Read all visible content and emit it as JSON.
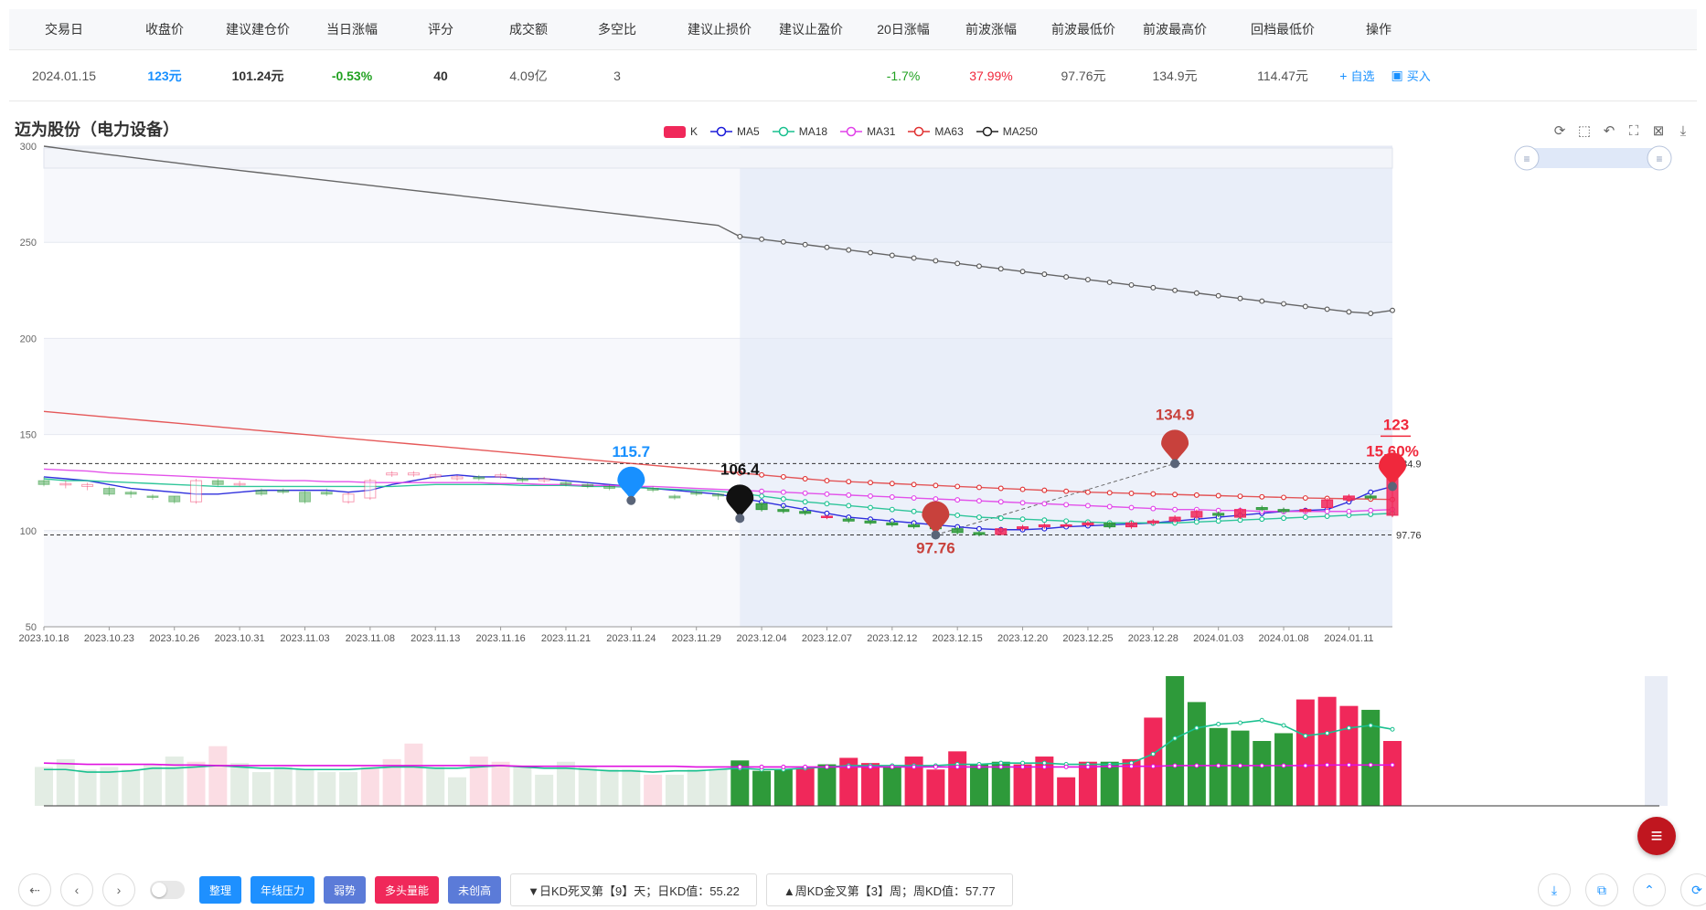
{
  "table": {
    "headers": [
      "交易日",
      "收盘价",
      "建议建仓价",
      "当日涨幅",
      "评分",
      "成交额",
      "多空比",
      "建议止损价",
      "建议止盈价",
      "20日涨幅",
      "前波涨幅",
      "前波最低价",
      "前波最高价",
      "回档最低价",
      "操作"
    ],
    "row": [
      "2024.01.15",
      "123元",
      "101.24元",
      "-0.53%",
      "40",
      "4.09亿",
      "3",
      "",
      "",
      "-1.7%",
      "37.99%",
      "97.76元",
      "134.9元",
      "114.47元"
    ],
    "ops": [
      "自选",
      "买入"
    ],
    "op_icons": [
      "plus-icon",
      "buy-icon"
    ]
  },
  "chart_title": "迈为股份（电力设备）",
  "legend": [
    {
      "name": "K",
      "color": "#f0285a"
    },
    {
      "name": "MA5",
      "color": "#1a1ad9"
    },
    {
      "name": "MA18",
      "color": "#19c08f"
    },
    {
      "name": "MA31",
      "color": "#e040e8"
    },
    {
      "name": "MA63",
      "color": "#e03030"
    },
    {
      "name": "MA250",
      "color": "#222222"
    }
  ],
  "toolbox_icons": [
    "refresh-icon",
    "zoom-area-icon",
    "zoom-reset-icon",
    "restore-icon",
    "data-view-icon",
    "download-icon"
  ],
  "chart_data": {
    "type": "candlestick",
    "y_ticks": [
      "300",
      "250",
      "200",
      "150",
      "100",
      "50"
    ],
    "ylim": [
      50,
      300
    ],
    "x_tick_labels": [
      "2023.10.18",
      "2023.10.23",
      "2023.10.26",
      "2023.10.31",
      "2023.11.03",
      "2023.11.08",
      "2023.11.13",
      "2023.11.16",
      "2023.11.21",
      "2023.11.24",
      "2023.11.29",
      "2023.12.04",
      "2023.12.07",
      "2023.12.12",
      "2023.12.15",
      "2023.12.20",
      "2023.12.25",
      "2023.12.28",
      "2024.01.03",
      "2024.01.08",
      "2024.01.11"
    ],
    "n_days": 63,
    "highlight_start_index": 32,
    "candles": [
      [
        126,
        124,
        128,
        123
      ],
      [
        124,
        124.5,
        126,
        122
      ],
      [
        123,
        124,
        125,
        121
      ],
      [
        122,
        119,
        123,
        118
      ],
      [
        120,
        119,
        121,
        117
      ],
      [
        118,
        117.5,
        119,
        116
      ],
      [
        118,
        115,
        118,
        114
      ],
      [
        115,
        126,
        127,
        114
      ],
      [
        126,
        124,
        127,
        123
      ],
      [
        124,
        124.5,
        126,
        123
      ],
      [
        121,
        119,
        122,
        118
      ],
      [
        121,
        120,
        122,
        119
      ],
      [
        120,
        115,
        121,
        114
      ],
      [
        120,
        119,
        122,
        118
      ],
      [
        115,
        119,
        120,
        114
      ],
      [
        117,
        126,
        127,
        116
      ],
      [
        129,
        130,
        131,
        128
      ],
      [
        129,
        130,
        131,
        128
      ],
      [
        128,
        129,
        130,
        127
      ],
      [
        127,
        128,
        129,
        126
      ],
      [
        128,
        127,
        129,
        126
      ],
      [
        128,
        129,
        130,
        127
      ],
      [
        127,
        126,
        128,
        125
      ],
      [
        126,
        127,
        128,
        125
      ],
      [
        125,
        124,
        126,
        123
      ],
      [
        124,
        123,
        125,
        122
      ],
      [
        123,
        122,
        124,
        121
      ],
      [
        122,
        121,
        123,
        120
      ],
      [
        122,
        121,
        123,
        120
      ],
      [
        118,
        117,
        119,
        116
      ],
      [
        120,
        119,
        121,
        118
      ],
      [
        119,
        118,
        119.5,
        116
      ],
      [
        116,
        113,
        117,
        112
      ],
      [
        114,
        111,
        115,
        110
      ],
      [
        111,
        110,
        113,
        109
      ],
      [
        110,
        109,
        111,
        108
      ],
      [
        107,
        107.5,
        108,
        106
      ],
      [
        106,
        105,
        107,
        104
      ],
      [
        105,
        104,
        106,
        103
      ],
      [
        104,
        103,
        105,
        102
      ],
      [
        103,
        102,
        104,
        101
      ],
      [
        102,
        101,
        103,
        100
      ],
      [
        101,
        99,
        102,
        98
      ],
      [
        99,
        98,
        100,
        97
      ],
      [
        98,
        101,
        102,
        97.8
      ],
      [
        101,
        102,
        103,
        100
      ],
      [
        102,
        103,
        104,
        101
      ],
      [
        103,
        103,
        104,
        102
      ],
      [
        103,
        104,
        105,
        102
      ],
      [
        104,
        102,
        104.5,
        101
      ],
      [
        102,
        104,
        105,
        101
      ],
      [
        104,
        105,
        106,
        103
      ],
      [
        105,
        107,
        108,
        104
      ],
      [
        107,
        110,
        111,
        106
      ],
      [
        109,
        108,
        110,
        107
      ],
      [
        107,
        111,
        112,
        106
      ],
      [
        112,
        111,
        113,
        110
      ],
      [
        111,
        110,
        112,
        109
      ],
      [
        110,
        111,
        112,
        109
      ],
      [
        112,
        116,
        117,
        111
      ],
      [
        116,
        118,
        119,
        115
      ],
      [
        118,
        117,
        119,
        116
      ],
      [
        108,
        130,
        134.9,
        107
      ]
    ],
    "candles_note_format": "[open, close, high, low]",
    "series": [
      {
        "name": "MA5",
        "values": [
          128,
          127,
          126,
          124,
          122,
          121,
          120,
          119,
          119,
          120,
          121,
          121,
          121,
          121,
          120,
          121,
          124,
          126,
          128,
          129,
          128,
          128,
          127,
          127,
          126,
          125,
          124,
          123,
          122,
          121,
          120,
          119,
          117,
          115,
          113,
          111,
          109,
          107,
          106,
          105,
          104,
          103,
          102,
          101,
          100.5,
          100.5,
          101,
          102,
          102.5,
          103,
          103.5,
          104,
          105,
          106,
          107,
          108,
          109,
          110,
          110.5,
          111,
          115,
          120,
          123
        ]
      },
      {
        "name": "MA18",
        "values": [
          127,
          126,
          126,
          125.5,
          125,
          124.5,
          124,
          123.5,
          123,
          123,
          123,
          123,
          123,
          123,
          123,
          123,
          123,
          123.5,
          124,
          124,
          124,
          124,
          123.5,
          123.5,
          123.5,
          123,
          123,
          122.5,
          122,
          121.5,
          121,
          120.5,
          119.5,
          118,
          116.5,
          115,
          114,
          113,
          112,
          111,
          110,
          109,
          108,
          107,
          106.5,
          106,
          105.5,
          105,
          104.5,
          104,
          104,
          104,
          104,
          104.5,
          105,
          105.5,
          106,
          106.5,
          107,
          107.5,
          108,
          108.5,
          109
        ]
      },
      {
        "name": "MA31",
        "values": [
          132,
          131.5,
          131,
          130,
          129.5,
          129,
          128.5,
          128,
          127.5,
          127,
          126.5,
          126,
          126,
          125.5,
          125.5,
          125,
          125,
          125,
          125,
          125,
          125,
          124.5,
          124.5,
          124,
          124,
          123.5,
          123.5,
          123,
          123,
          122.5,
          122,
          121.5,
          121,
          120.5,
          120,
          119.5,
          119,
          118.5,
          118,
          117.5,
          117,
          116.5,
          116,
          115.5,
          115,
          114.5,
          114,
          113.5,
          113,
          112.5,
          112,
          111.5,
          111,
          111,
          110.5,
          110.5,
          110,
          110,
          110,
          110,
          110,
          110.5,
          111
        ]
      },
      {
        "name": "MA63",
        "values": [
          162,
          161,
          160,
          159,
          158,
          157,
          156,
          155,
          154,
          153,
          152,
          151,
          150,
          149,
          148,
          147,
          146,
          145,
          144,
          143,
          142,
          141,
          140,
          139,
          138,
          137,
          136,
          135,
          134,
          133,
          132,
          131,
          130,
          129,
          128,
          127,
          126,
          125.5,
          125,
          124.5,
          124,
          123.5,
          123,
          122.5,
          122,
          121.5,
          121,
          120.5,
          120,
          119.7,
          119.4,
          119.1,
          118.8,
          118.5,
          118.2,
          117.9,
          117.6,
          117.3,
          117,
          116.8,
          116.6,
          116.4,
          116.2
        ]
      },
      {
        "name": "MA250",
        "values": [
          300,
          298.5,
          297,
          295.6,
          294.2,
          292.8,
          291.4,
          290,
          288.7,
          287.4,
          286.1,
          284.8,
          283.5,
          282.2,
          280.9,
          279.6,
          278.3,
          277,
          275.7,
          274.4,
          273.1,
          271.8,
          270.5,
          269.2,
          267.9,
          266.6,
          265.3,
          264,
          262.7,
          261.4,
          260.1,
          258.8,
          253,
          251.6,
          250.2,
          248.8,
          247.4,
          246,
          244.6,
          243.2,
          241.8,
          240.4,
          239,
          237.6,
          236.2,
          234.8,
          233.4,
          232,
          230.6,
          229.2,
          227.8,
          226.4,
          225,
          223.6,
          222.2,
          220.8,
          219.4,
          218,
          216.6,
          215.2,
          213.8,
          213,
          214.6
        ]
      }
    ],
    "ref_lines": [
      {
        "value": 134.9,
        "label": "134.9"
      },
      {
        "value": 97.76,
        "label": "97.76"
      }
    ],
    "markers": [
      {
        "index": 27,
        "value": 115.7,
        "label": "115.7",
        "color": "#1890ff"
      },
      {
        "index": 32,
        "value": 106.4,
        "label": "106.4",
        "color": "#111111"
      },
      {
        "index": 41,
        "value": 97.76,
        "label": "97.76",
        "color": "#c8413c",
        "below": true
      },
      {
        "index": 52,
        "value": 134.9,
        "label": "134.9",
        "color": "#c8413c"
      },
      {
        "index": 62,
        "value": 123,
        "label": "123",
        "color": "#f0283c",
        "pct": "15.60%"
      }
    ],
    "volume": {
      "values": [
        30,
        36,
        28,
        30,
        28,
        32,
        38,
        34,
        46,
        33,
        26,
        30,
        28,
        26,
        26,
        30,
        36,
        48,
        30,
        22,
        38,
        34,
        30,
        24,
        34,
        30,
        28,
        28,
        24,
        24,
        28,
        28,
        35,
        27,
        28,
        29,
        32,
        37,
        33,
        30,
        38,
        28,
        42,
        32,
        34,
        32,
        38,
        22,
        34,
        34,
        36,
        68,
        100,
        80,
        60,
        58,
        50,
        56,
        82,
        84,
        77,
        74,
        50
      ],
      "up": [
        false,
        false,
        false,
        false,
        false,
        false,
        false,
        true,
        true,
        false,
        false,
        false,
        false,
        false,
        false,
        true,
        true,
        true,
        false,
        false,
        true,
        true,
        false,
        false,
        false,
        false,
        false,
        false,
        true,
        false,
        false,
        false,
        false,
        false,
        false,
        true,
        false,
        true,
        true,
        false,
        true,
        true,
        true,
        false,
        false,
        true,
        true,
        true,
        true,
        false,
        true,
        true,
        false,
        false,
        false,
        false,
        false,
        false,
        true,
        true,
        true,
        false,
        true
      ],
      "ma_fast": [
        28,
        28,
        26,
        26,
        27,
        29,
        29,
        30,
        31,
        30,
        29,
        29,
        28,
        28,
        28,
        29,
        30,
        30,
        29,
        29,
        30,
        31,
        30,
        29,
        29,
        28,
        27,
        27,
        26,
        27,
        27,
        28,
        29,
        28,
        28,
        29,
        30,
        31,
        31,
        31,
        31,
        31,
        32,
        32,
        33,
        33,
        33,
        32,
        32,
        32,
        33,
        40,
        52,
        60,
        63,
        64,
        66,
        62,
        54,
        56,
        60,
        62,
        59
      ],
      "ma_slow": [
        33,
        32.5,
        32,
        32,
        32,
        32,
        31.5,
        31.5,
        31,
        31,
        31,
        31,
        31,
        31,
        31,
        31,
        31,
        31,
        31,
        31,
        31,
        31,
        30.5,
        30.5,
        30.5,
        30.5,
        30.5,
        30.5,
        30.5,
        30.5,
        30,
        30,
        30,
        30,
        30,
        30,
        30,
        30,
        30,
        30,
        30,
        30,
        30,
        30,
        30,
        30,
        30,
        30,
        30,
        30.5,
        30.5,
        30.5,
        31,
        31,
        31,
        31,
        31,
        31,
        31,
        31.5,
        31.5,
        31.5,
        31.5
      ]
    }
  },
  "bottom": {
    "nav_icons": [
      "back-icon",
      "prev-icon",
      "next-icon"
    ],
    "tags": [
      {
        "label": "整理",
        "color": "#1e90ff"
      },
      {
        "label": "年线压力",
        "color": "#1e90ff"
      },
      {
        "label": "弱势",
        "color": "#5b7bd8"
      },
      {
        "label": "多头量能",
        "color": "#f0285a"
      },
      {
        "label": "未创高",
        "color": "#5b7bd8"
      }
    ],
    "info1": "▼日KD死叉第【9】天；日KD值：55.22",
    "info2": "▲周KD金叉第【3】周；周KD值：57.77",
    "right_icons": [
      "download-icon",
      "copy-icon",
      "up-icon",
      "refresh-icon"
    ],
    "fab_icon": "menu-icon"
  }
}
